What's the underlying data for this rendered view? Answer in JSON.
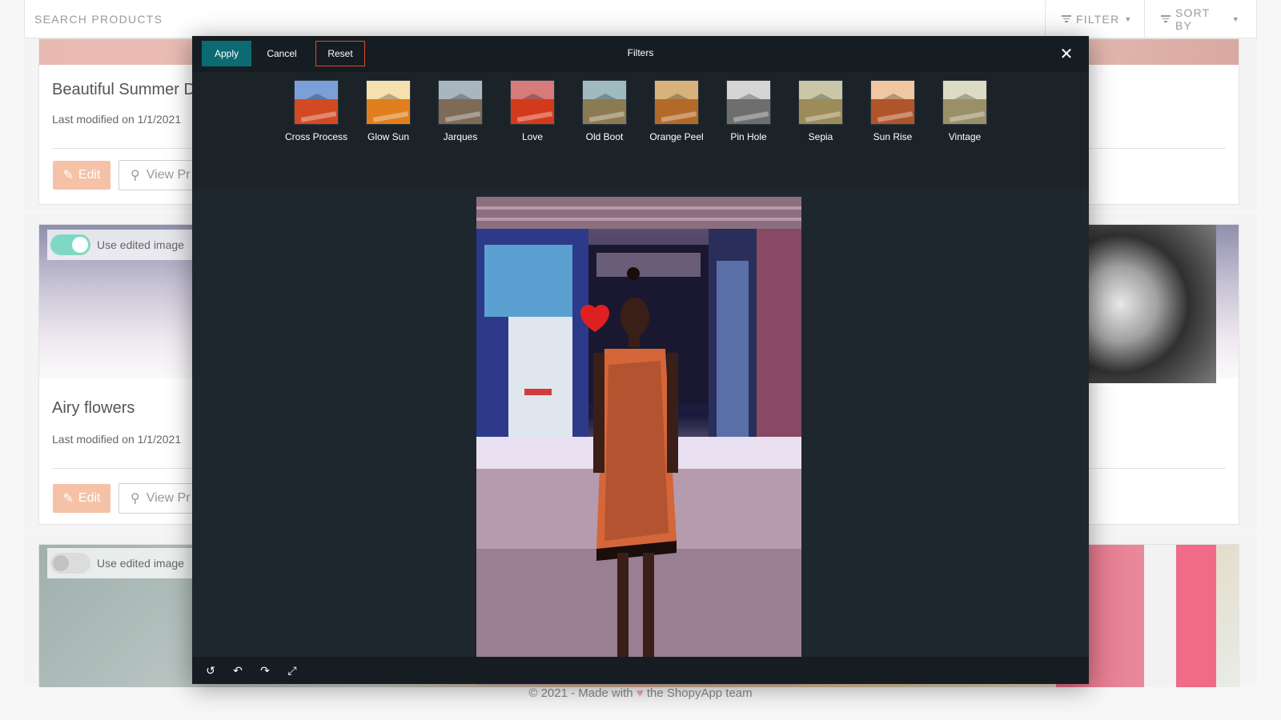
{
  "topbar": {
    "search_placeholder": "SEARCH PRODUCTS",
    "filter_label": "FILTER",
    "sort_label": "SORT BY"
  },
  "cards": [
    {
      "title": "Beautiful Summer D",
      "meta": "Last modified on 1/1/2021",
      "edit": "Edit",
      "view": "View Pr"
    },
    {
      "title": "Airy flowers",
      "meta": "Last modified on 1/1/2021",
      "edit": "Edit",
      "view": "View Pr",
      "toggle_label": "Use edited image",
      "toggle_on": true
    },
    {
      "toggle_label": "Use edited image",
      "toggle_on": false
    }
  ],
  "footer": {
    "prefix": "© 2021 - Made with",
    "heart": "♥",
    "suffix": "the ShopyApp team"
  },
  "modal": {
    "apply_label": "Apply",
    "cancel_label": "Cancel",
    "reset_label": "Reset",
    "title": "Filters",
    "close_glyph": "✕",
    "filters": [
      {
        "label": "Cross Process",
        "sky": "#7ba0d8",
        "ground": "#d14a22"
      },
      {
        "label": "Glow Sun",
        "sky": "#f7e0b0",
        "ground": "#e07f1b"
      },
      {
        "label": "Jarques",
        "sky": "#a7b6bf",
        "ground": "#7d6a57"
      },
      {
        "label": "Love",
        "sky": "#d77a7a",
        "ground": "#d33a1c"
      },
      {
        "label": "Old Boot",
        "sky": "#9fbac0",
        "ground": "#8c7a52"
      },
      {
        "label": "Orange Peel",
        "sky": "#d8b27c",
        "ground": "#b36a28"
      },
      {
        "label": "Pin Hole",
        "sky": "#d5d5d5",
        "ground": "#6e6e6e"
      },
      {
        "label": "Sepia",
        "sky": "#c9c7a8",
        "ground": "#9c8c5a"
      },
      {
        "label": "Sun Rise",
        "sky": "#f0c7a0",
        "ground": "#b0552a"
      },
      {
        "label": "Vintage",
        "sky": "#dcdcc4",
        "ground": "#9a9068"
      }
    ],
    "tools": [
      "↺",
      "↶",
      "↷",
      "⤢"
    ]
  },
  "colors": {
    "apply": "#0c6b72",
    "reset_border": "#e2492e",
    "edit": "#f5c2a7",
    "toggle_on": "#7fd8c4"
  }
}
